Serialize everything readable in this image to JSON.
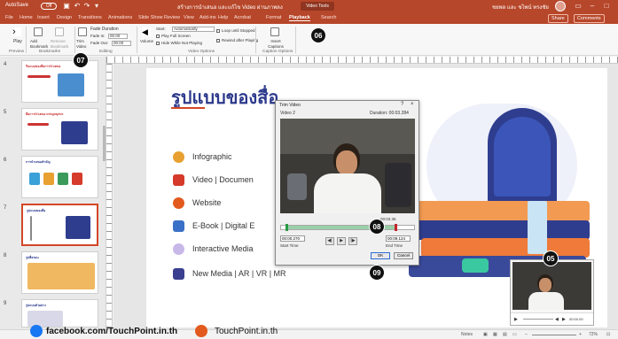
{
  "titlebar": {
    "autosave": "AutoSave",
    "autosave_state": "Off",
    "filename": "สร้างการนำเสนอ และแก้ไข Video ผ่านภาพลง",
    "context": "Video Tools",
    "user": "ชยพล และ ชไพน์ ทรงชัย"
  },
  "tabs": [
    "File",
    "Home",
    "Insert",
    "Design",
    "Transitions",
    "Animations",
    "Slide Show",
    "Review",
    "View",
    "Add-ins",
    "Help",
    "Acrobat",
    "Format",
    "Playback",
    "Search"
  ],
  "active_tab": "Playback",
  "share": [
    "Share",
    "Comments"
  ],
  "ribbon": {
    "play": "Play",
    "add_bookmark": "Add Bookmark",
    "remove_bookmark": "Remove Bookmark",
    "trim_video": "Trim Video",
    "fade_duration": "Fade Duration",
    "fade_in": "Fade In:",
    "fade_in_value": "00.00",
    "fade_out": "Fade Out:",
    "fade_out_value": "00.00",
    "volume": "Volume",
    "start": "Start:",
    "start_value": "Automatically",
    "play_full_screen": "Play Full Screen",
    "hide_while_not_playing": "Hide While Not Playing",
    "loop_until_stopped": "Loop until Stopped",
    "rewind_after_playing": "Rewind after Playing",
    "insert_captions": "Insert Captions",
    "groups": [
      "Preview",
      "Bookmarks",
      "Editing",
      "Video Options",
      "Caption Options"
    ]
  },
  "thumbnails": [
    {
      "num": "4",
      "title": "รีบแบบของสื่อการนำเสนอ"
    },
    {
      "num": "5",
      "title": "สื่อการนำเสนอ Infographic"
    },
    {
      "num": "6",
      "title": "การนำเสนอสำคัญ"
    },
    {
      "num": "7",
      "title": "รูปแบบของสื่อ"
    },
    {
      "num": "8",
      "title": "รูปสื่อรอบ"
    },
    {
      "num": "9",
      "title": "รูปแบบตัวอย่าง"
    }
  ],
  "slide": {
    "title": "รูปแบบของสื่อ",
    "items": [
      {
        "label": "Infographic",
        "color": "#e8a030"
      },
      {
        "label": "Video | Documen",
        "color": "#d63a2a"
      },
      {
        "label": "Website",
        "color": "#e35a1e"
      },
      {
        "label": "E-Book | Digital E",
        "color": "#3a70c8"
      },
      {
        "label": "Interactive Media",
        "color": "#8a6ac8"
      },
      {
        "label": "New Media | AR | VR | MR",
        "color": "#3a3f8f"
      }
    ]
  },
  "dialog": {
    "title": "Trim Video",
    "help": "?",
    "close": "×",
    "video_name": "Video 2",
    "duration": "Duration: 00:03.284",
    "current_time": "00:03.35",
    "start_time_label": "Start Time",
    "start_time": "00:00.270",
    "end_time_label": "End Time",
    "end_time": "00:09.124",
    "ok": "OK",
    "cancel": "Cancel",
    "trim_start_fraction": 0.03,
    "trim_end_fraction": 0.85
  },
  "callouts": [
    "05",
    "06",
    "07",
    "08",
    "09"
  ],
  "video_controls": {
    "time": "00:00.00"
  },
  "status": {
    "slide": "Slide 7 of 12",
    "notes": "Notes",
    "zoom": "72%"
  },
  "watermark": {
    "facebook": "facebook.com/TouchPoint.in.th",
    "web": "TouchPoint.in.th"
  }
}
